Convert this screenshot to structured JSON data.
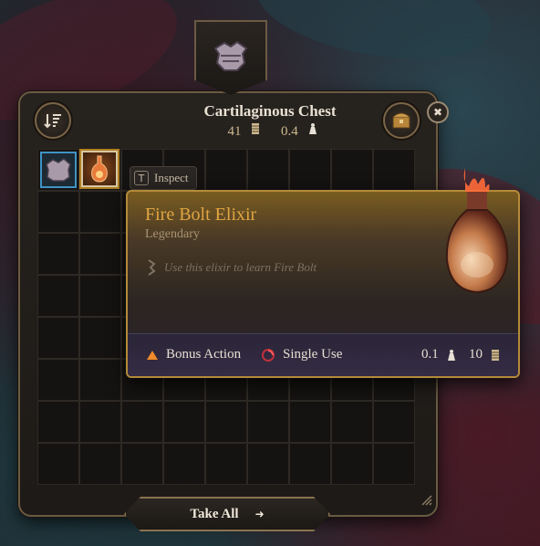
{
  "container": {
    "title": "Cartilaginous Chest",
    "gold": "41",
    "weight": "0.4"
  },
  "inspect_hint": {
    "key": "T",
    "label": "Inspect"
  },
  "tooltip": {
    "name": "Fire Bolt Elixir",
    "rarity": "Legendary",
    "description": "Use this elixir to learn Fire Bolt",
    "action_label": "Bonus Action",
    "use_label": "Single Use",
    "weight": "0.1",
    "value": "10"
  },
  "footer": {
    "take_all_label": "Take All",
    "arrow": "➜"
  },
  "close_glyph": "✖",
  "colors": {
    "accent_gold": "#e0a541",
    "rarity_border": "#b48a3a",
    "selected_slot": "#3f93c4",
    "panel_border": "#6b5a43"
  },
  "icons": [
    "sort-icon",
    "loot-chest-icon",
    "close-icon",
    "coin-stack-icon",
    "weight-icon",
    "bonus-action-icon",
    "single-use-icon",
    "arrow-right-icon",
    "resize-grip-icon"
  ]
}
